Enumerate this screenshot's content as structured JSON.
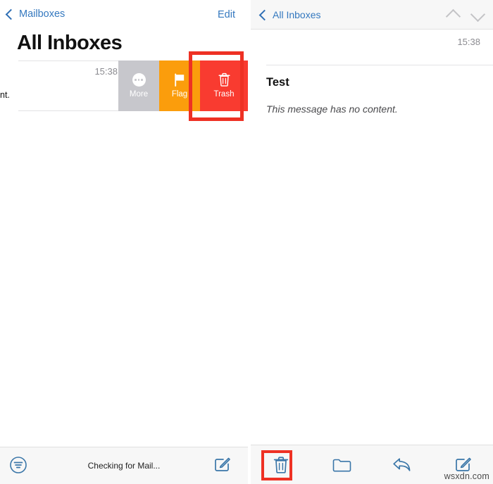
{
  "left_panel": {
    "nav": {
      "back_label": "Mailboxes",
      "back_icon": "chevron-left-icon",
      "edit_label": "Edit"
    },
    "title": "All Inboxes",
    "row": {
      "preview_truncated": "nt.",
      "time": "15:38",
      "disclosure_icon": "chevron-right-icon"
    },
    "swipe_actions": [
      {
        "label": "More",
        "icon": "ellipsis-circle-icon",
        "color": "#c7c7cc"
      },
      {
        "label": "Flag",
        "icon": "flag-icon",
        "color": "#fb9d0c"
      },
      {
        "label": "Trash",
        "icon": "trash-icon",
        "color": "#f93b30"
      }
    ],
    "toolbar": {
      "filter_icon": "filter-circle-icon",
      "status": "Checking for Mail...",
      "compose_icon": "compose-icon"
    }
  },
  "right_panel": {
    "nav": {
      "back_label": "All Inboxes",
      "back_icon": "chevron-left-icon",
      "up_icon": "chevron-up-icon",
      "down_icon": "chevron-down-icon"
    },
    "message": {
      "time": "15:38",
      "subject": "Test",
      "body": "This message has no content."
    },
    "toolbar": [
      {
        "icon": "trash-icon",
        "name": "delete-button"
      },
      {
        "icon": "folder-icon",
        "name": "move-button"
      },
      {
        "icon": "reply-arrow-icon",
        "name": "reply-button"
      },
      {
        "icon": "compose-icon",
        "name": "compose-button"
      }
    ]
  },
  "annotations": {
    "highlight_color": "#ee3124",
    "trash_swipe_highlight": "Trash",
    "trash_toolbar_highlight": "delete-button"
  },
  "watermark": "wsxdn.com"
}
